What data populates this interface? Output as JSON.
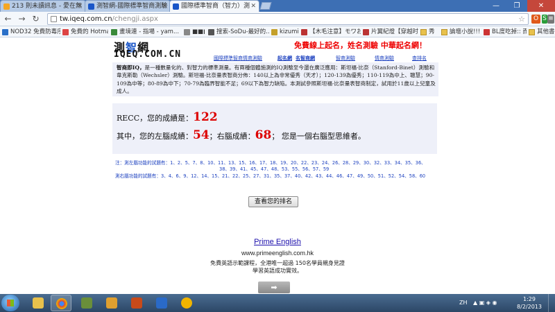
{
  "tabs": [
    {
      "title": "213 則未讀訊息 - 愛在無",
      "color": "#f5a623"
    },
    {
      "title": "測智網-國際標準智商測驗",
      "color": "#1a56c8"
    },
    {
      "title": "國際標準智商（智力）測",
      "color": "#1a56c8"
    }
  ],
  "window": {
    "minimize": "—",
    "maximize": "❐",
    "close": "✕"
  },
  "toolbar": {
    "back": "←",
    "forward": "→",
    "reload": "↻",
    "url_host": "tw.iqeq.com.cn",
    "url_path": "/chengji.aspx",
    "star": "☆"
  },
  "extensions": [
    {
      "label": "O",
      "color": "#e05a1a"
    },
    {
      "label": "S",
      "color": "#2a9d3a"
    },
    {
      "label": "≡",
      "color": "#777777"
    }
  ],
  "bookmarks": [
    {
      "label": "NOD32 免費防毒序...",
      "color": "#2a70c8"
    },
    {
      "label": "免費的 Hotmail",
      "color": "#d44"
    },
    {
      "label": "畫境連 - 指場 - yam...",
      "color": "#3a8a3a"
    },
    {
      "label": "■■■",
      "color": "#888"
    },
    {
      "label": "搜索-SoDu-最好的...",
      "color": "#555"
    },
    {
      "label": "kizumi",
      "color": "#c4a02a"
    },
    {
      "label": "【木毛注意】モワお...",
      "color": "#b33"
    },
    {
      "label": "片翼紀燈【穿越时...",
      "color": "#b33"
    },
    {
      "label": "秀",
      "color": "#e8c14c"
    },
    {
      "label": "論壇小說!!!",
      "color": "#e8c14c"
    },
    {
      "label": "BL度吃掉:: 而忘最...",
      "color": "#c33"
    },
    {
      "label": "其他書籤",
      "color": "#e8c14c"
    }
  ],
  "site": {
    "logo_cn_a": "測",
    "logo_cn_b": "智",
    "logo_cn_c": "網",
    "logo_en": "IQEQ.COM.CN",
    "tagline": "免費線上起名，姓名測驗  中華起名網！",
    "nav": [
      "國際標準智商情商測驗",
      "起名網",
      "名智商網",
      "智商測驗",
      "情商測驗",
      "查排名"
    ]
  },
  "intro": {
    "bold": "智商即IQ，",
    "text": "是一種數量化的、對智力的標準測量。有兩種個體施測的IQ測驗至今還在廣泛應用：斯坦福-比奈（Stanford-Binet）測驗和韋克斯勒（Wechsler）測驗。斯坦福-比奈量表智商分佈：140以上為非常優秀（天才）；120-139為優秀；110-119為中上、聰慧；90-109為中等；80-89為中下；70-79為臨界智能不足；69以下為智力缺陷。本測試參照斯坦福-比奈量表智商制定，試用於11歲以上兒童及成人。"
  },
  "result": {
    "recc_label": "RECC，您的成績是：",
    "recc_score": "122",
    "line2_a": "其中，您的左腦成績：",
    "left_score": "54",
    "line2_b": "；右腦成績：",
    "right_score": "68",
    "line2_c": "；  您是一個右腦型思維者。"
  },
  "questions": {
    "left_label": "注：測左腦功能的試題有：",
    "left_row1": "1、2、5、7、8、10、11、13、15、16、17、18、19、20、22、23、24、26、28、29、30、32、33、34、35、36、",
    "left_row2": "38、39、41、45、47、48、53、55、56、57、59",
    "right_label": "測右腦功能的試題有：",
    "right_row": "3、4、6、9、12、14、15、21、22、25、27、31、35、37、40、42、43、44、46、47、49、50、51、52、54、58、60"
  },
  "rank_button": "查看您的排名",
  "ad": {
    "title": "Prime English",
    "url": "www.primeenglish.com.hk",
    "text": "免費英語示範課程，全港唯一超過 150名學員親身見證學習英語成功實效。",
    "arrow": "➡"
  },
  "taskbar": {
    "apps": [
      {
        "name": "explorer",
        "color": "#e8c14c"
      },
      {
        "name": "chrome",
        "color": "#db4437"
      },
      {
        "name": "app3",
        "color": "#6a8f3a"
      },
      {
        "name": "app4",
        "color": "#e0a030"
      },
      {
        "name": "app5",
        "color": "#c84a1a"
      },
      {
        "name": "app6",
        "color": "#2a6ac8"
      },
      {
        "name": "app7",
        "color": "#f0b400"
      }
    ],
    "lang": "ZH",
    "time": "1:29",
    "date": "8/2/2013"
  }
}
